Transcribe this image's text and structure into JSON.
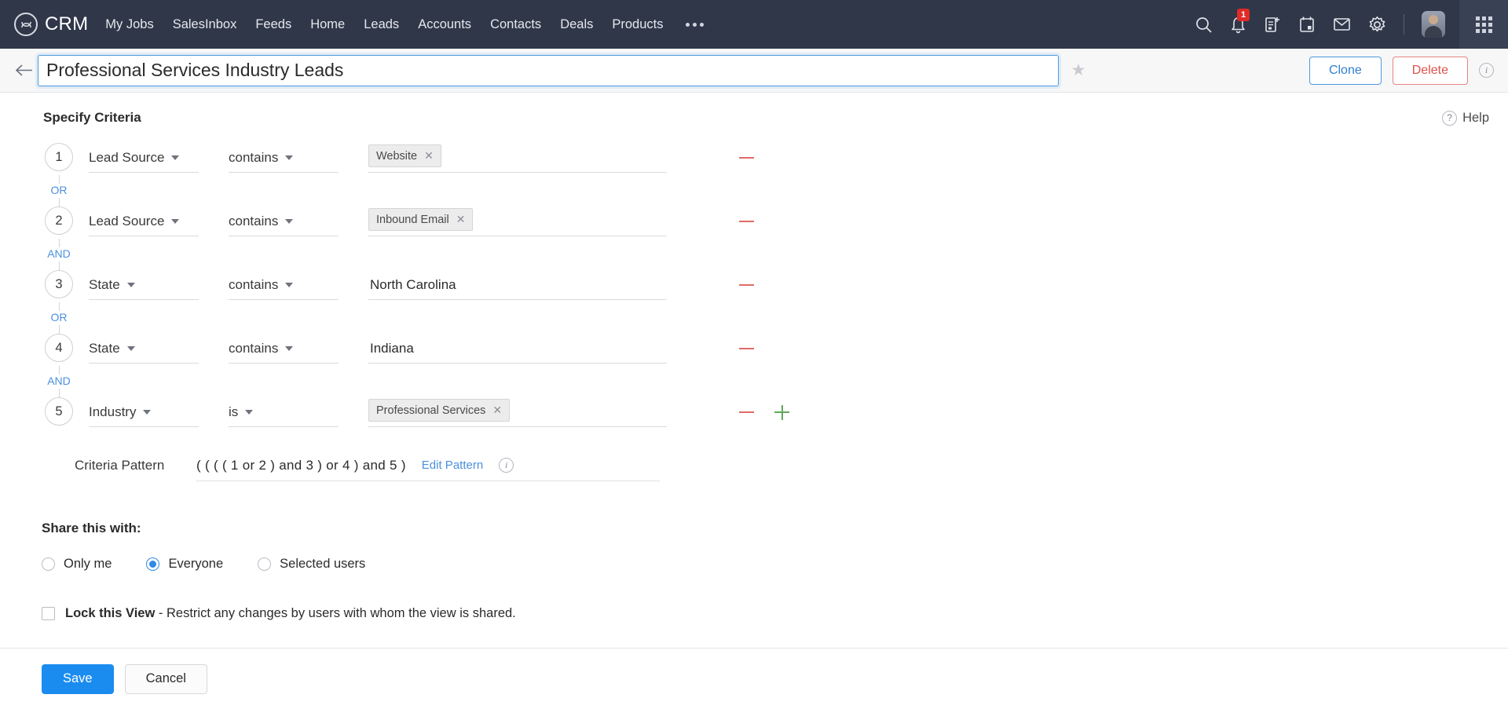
{
  "topnav": {
    "brand": "CRM",
    "brand_icon": "crm-logo-icon",
    "links": [
      "My Jobs",
      "SalesInbox",
      "Feeds",
      "Home",
      "Leads",
      "Accounts",
      "Contacts",
      "Deals",
      "Products"
    ],
    "more_label": "more-menu-icon",
    "icons": [
      "search-icon",
      "notifications-bell-icon",
      "add-note-icon",
      "calendar-icon",
      "mail-icon",
      "settings-gear-icon"
    ],
    "notification_count": "1",
    "avatar_label": "user-avatar",
    "apps_label": "apps-grid-icon",
    "bg_color": "#2f3749"
  },
  "titlebar": {
    "back_label": "back-arrow-icon",
    "view_name": "Professional Services Industry Leads",
    "view_name_placeholder": "Enter view name",
    "star_label": "favorite-star-icon",
    "clone_label": "Clone",
    "delete_label": "Delete",
    "info_label": "i",
    "clone_color": "#2f7fd0",
    "delete_color": "#e0524c"
  },
  "criteria_section": {
    "title": "Specify Criteria",
    "help_label": "Help",
    "help_icon": "?",
    "rows": [
      {
        "num": "1",
        "field": "Lead Source",
        "operator": "contains",
        "value_type": "chip",
        "chips": [
          "Website"
        ],
        "connector": "OR"
      },
      {
        "num": "2",
        "field": "Lead Source",
        "operator": "contains",
        "value_type": "chip",
        "chips": [
          "Inbound Email"
        ],
        "connector": "AND"
      },
      {
        "num": "3",
        "field": "State",
        "operator": "contains",
        "value_type": "text",
        "value": "North Carolina",
        "connector": "OR"
      },
      {
        "num": "4",
        "field": "State",
        "operator": "contains",
        "value_type": "text",
        "value": "Indiana",
        "connector": "AND"
      },
      {
        "num": "5",
        "field": "Industry",
        "operator": "is",
        "value_type": "chip",
        "chips": [
          "Professional Services"
        ],
        "connector": ""
      }
    ],
    "remove_icon": "remove-criteria-icon",
    "add_icon": "add-criteria-icon"
  },
  "pattern": {
    "label": "Criteria Pattern",
    "value": "( ( ( ( 1 or 2 ) and 3 ) or 4 ) and 5 )",
    "edit_label": "Edit Pattern",
    "info_label": "i"
  },
  "share": {
    "title": "Share this with:",
    "options": [
      {
        "label": "Only me",
        "selected": false
      },
      {
        "label": "Everyone",
        "selected": true
      },
      {
        "label": "Selected users",
        "selected": false
      }
    ]
  },
  "lock": {
    "checked": false,
    "bold_label": "Lock this View",
    "rest_label": " - Restrict any changes by users with whom the view is shared."
  },
  "footer": {
    "save_label": "Save",
    "cancel_label": "Cancel",
    "save_color": "#1a8cf0"
  }
}
